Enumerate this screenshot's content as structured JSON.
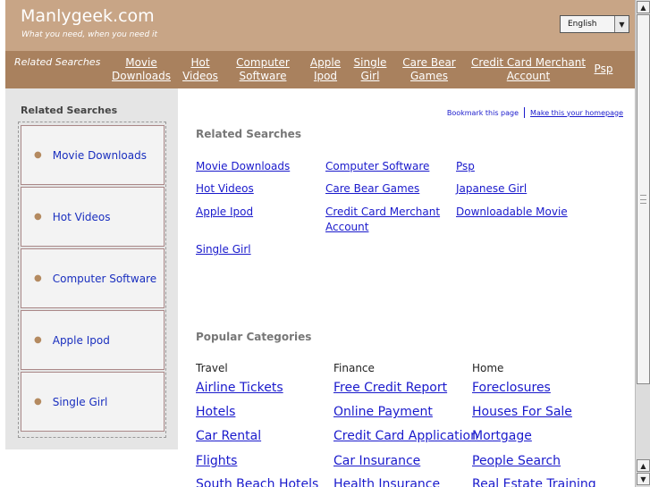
{
  "header": {
    "title": "Manlygeek.com",
    "tagline": "What you need, when you need it",
    "language": "English"
  },
  "nav": {
    "heading": "Related Searches",
    "links": [
      {
        "label": "Movie Downloads",
        "l1": "Movie",
        "l2": "Downloads"
      },
      {
        "label": "Hot Videos",
        "l1": "Hot",
        "l2": "Videos"
      },
      {
        "label": "Computer Software",
        "l1": "Computer",
        "l2": "Software"
      },
      {
        "label": "Apple Ipod",
        "l1": "Apple",
        "l2": "Ipod"
      },
      {
        "label": "Single Girl",
        "l1": "Single",
        "l2": "Girl"
      },
      {
        "label": "Care Bear Games",
        "l1": "Care Bear",
        "l2": "Games"
      },
      {
        "label": "Credit Card Merchant Account",
        "l1": "Credit Card Merchant",
        "l2": "Account"
      },
      {
        "label": "Psp",
        "l1": "Psp",
        "l2": ""
      }
    ]
  },
  "sidebar": {
    "title": "Related Searches",
    "items": [
      "Movie Downloads",
      "Hot Videos",
      "Computer Software",
      "Apple Ipod",
      "Single Girl"
    ]
  },
  "toplinks": {
    "bookmark": "Bookmark this page",
    "homepage": "Make this your homepage"
  },
  "related": {
    "title": "Related Searches",
    "links": [
      "Movie Downloads",
      "Computer Software",
      "Psp",
      "Hot Videos",
      "Care Bear Games",
      "Japanese Girl",
      "Apple Ipod",
      "Credit Card Merchant Account",
      "Downloadable Movie",
      "Single Girl"
    ]
  },
  "popular": {
    "title": "Popular Categories",
    "columns": [
      {
        "heading": "Travel",
        "links": [
          "Airline Tickets",
          "Hotels",
          "Car Rental",
          "Flights",
          "South Beach Hotels"
        ]
      },
      {
        "heading": "Finance",
        "links": [
          "Free Credit Report",
          "Online Payment",
          "Credit Card Application",
          "Car Insurance",
          "Health Insurance"
        ]
      },
      {
        "heading": "Home",
        "links": [
          "Foreclosures",
          "Houses For Sale",
          "Mortgage",
          "People Search",
          "Real Estate Training"
        ]
      }
    ]
  },
  "colors": {
    "header_bg": "#c8a586",
    "nav_bg": "#a9815e",
    "link": "#1a1acc",
    "sidebar_bg": "#e5e5e5"
  }
}
